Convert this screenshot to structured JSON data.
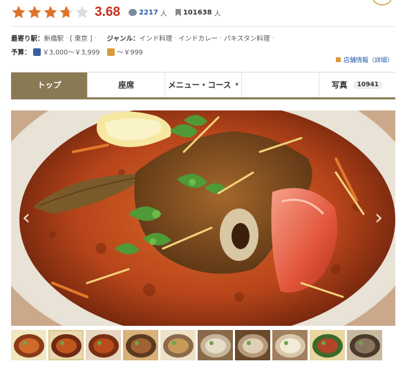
{
  "rating": {
    "stars": 3.68,
    "score_text": "3.68",
    "reviews_count": "2217",
    "reviews_unit": "人",
    "saves_count": "101638",
    "saves_unit": "人"
  },
  "info": {
    "station_label": "最寄り駅：",
    "station_value": "新橋駅",
    "area_value": "[ 東京 ]",
    "genre_label": "ジャンル：",
    "genres": [
      "インド料理",
      "インドカレー",
      "パキスタン料理"
    ],
    "budget_label": "予算：",
    "dinner_budget": "￥3,000～￥3,999",
    "lunch_budget": "～￥999",
    "store_info_link": "店舗情報（詳細）"
  },
  "tabs": [
    {
      "label": "トップ",
      "active": true
    },
    {
      "label": "座席"
    },
    {
      "label": "メニュー・コース",
      "chevron": "▾"
    },
    {
      "label": ""
    },
    {
      "label": "写真",
      "badge": "10941"
    }
  ],
  "colors": {
    "star": "#e0702a",
    "score": "#c8311d",
    "tab_active": "#8a7a54"
  },
  "gallery": {
    "main_photo_icon": "curry-photo",
    "prev_icon": "chevron-left-icon",
    "next_icon": "chevron-right-icon",
    "prev_glyph": "‹",
    "next_glyph": "›",
    "thumbnails": [
      "curry-bowl",
      "curry-plate",
      "stew-dish",
      "spread",
      "thali",
      "dining-room",
      "table-set",
      "naan",
      "tandoori",
      "interior"
    ]
  }
}
